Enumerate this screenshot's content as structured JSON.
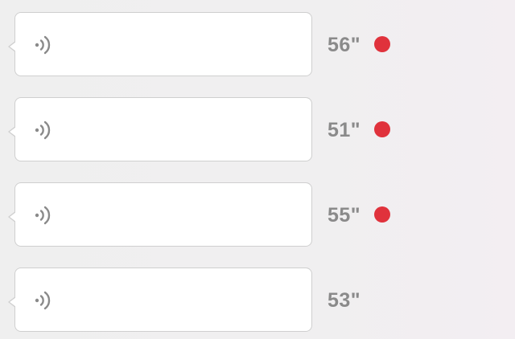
{
  "messages": [
    {
      "duration": "56\"",
      "unread": true,
      "icon": "voice-wave-icon"
    },
    {
      "duration": "51\"",
      "unread": true,
      "icon": "voice-wave-icon"
    },
    {
      "duration": "55\"",
      "unread": true,
      "icon": "voice-wave-icon"
    },
    {
      "duration": "53\"",
      "unread": false,
      "icon": "voice-wave-icon"
    }
  ],
  "colors": {
    "unread_dot": "#e0323c",
    "duration_text": "#8a8a8a",
    "bubble_bg": "#ffffff",
    "icon": "#8a8a8a"
  }
}
